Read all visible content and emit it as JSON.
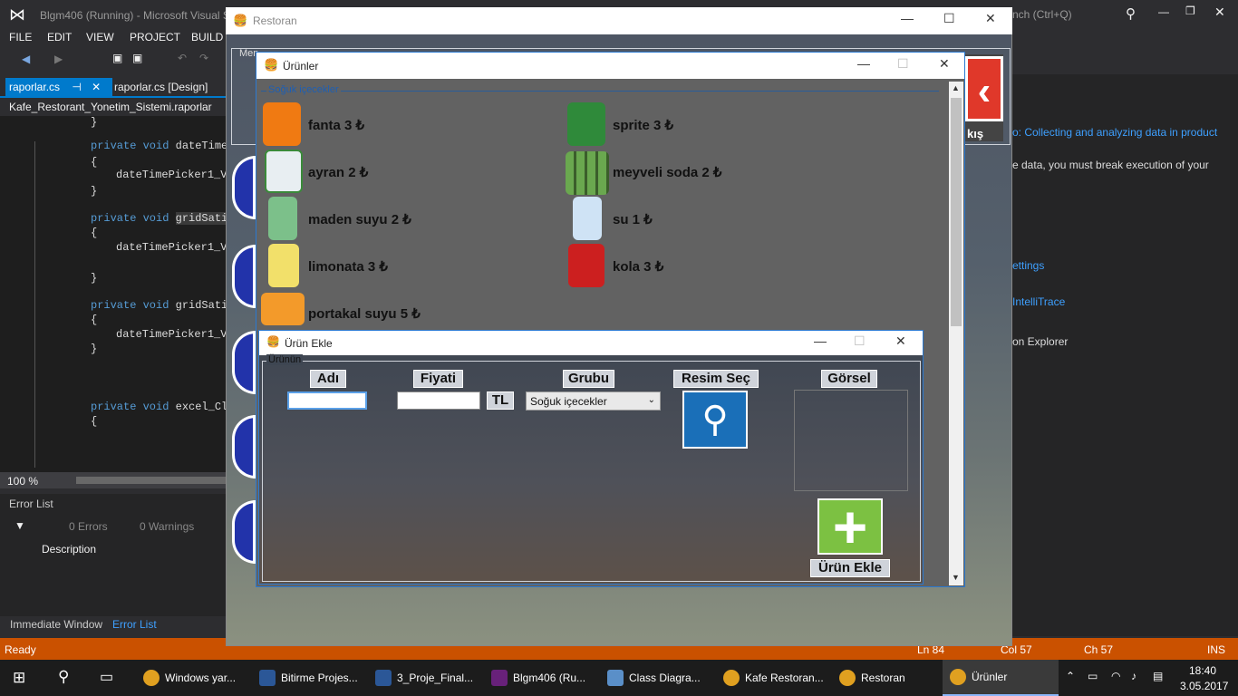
{
  "vs": {
    "title": "Blgm406 (Running) - Microsoft Visual S",
    "menu": [
      "FILE",
      "EDIT",
      "VIEW",
      "PROJECT",
      "BUILD"
    ],
    "search_fragment": "nch (Ctrl+Q)",
    "tabs": [
      "raporlar.cs",
      "raporlar.cs [Design]"
    ],
    "breadcrumb": "Kafe_Restorant_Yonetim_Sistemi.raporlar",
    "code": [
      {
        "text": "}"
      },
      {
        "kw": "private void ",
        "text": "dateTime"
      },
      {
        "text": "{"
      },
      {
        "text": "dateTimePicker1_Va"
      },
      {
        "text": "}"
      },
      {
        "kw": "private void ",
        "text": "gridSati"
      },
      {
        "text": "{"
      },
      {
        "text": "dateTimePicker1_Va"
      },
      {
        "text": "}"
      },
      {
        "kw": "private void ",
        "text": "gridSati"
      },
      {
        "text": "{"
      },
      {
        "text": "dateTimePicker1_Va"
      },
      {
        "text": "}"
      },
      {
        "kw": "private void ",
        "text": "excel_Cl"
      },
      {
        "text": "{"
      }
    ],
    "zoom": "100 %",
    "error_list": {
      "title": "Error List",
      "errors": "0 Errors",
      "warnings": "0 Warnings",
      "column": "Description"
    },
    "bottom_tabs": [
      "Immediate Window",
      "Error List"
    ],
    "right_panel": {
      "link": "o: Collecting and analyzing data in product",
      "text": "e data, you must break execution of your",
      "settings": "ettings",
      "intellitrace": "IntelliTrace",
      "explorer": "on Explorer"
    },
    "status": {
      "ready": "Ready",
      "ln": "Ln 84",
      "col": "Col 57",
      "ch": "Ch 57",
      "ins": "INS"
    }
  },
  "restoran": {
    "title": "Restoran",
    "group_fragment": "Men",
    "exit_fragment": "kış"
  },
  "urunler": {
    "title": "Ürünler",
    "group": "Soğuk içecekler",
    "products": [
      {
        "name": "fanta 3 ₺",
        "color": "#f07a12"
      },
      {
        "name": "sprite 3 ₺",
        "color": "#2f8a3a"
      },
      {
        "name": "ayran 2 ₺",
        "color": "#e8eef2"
      },
      {
        "name": "meyveli soda 2 ₺",
        "color": "#6aa84f"
      },
      {
        "name": "maden suyu 2 ₺",
        "color": "#7cc08a"
      },
      {
        "name": "su 1 ₺",
        "color": "#cfe3f5"
      },
      {
        "name": "limonata 3 ₺",
        "color": "#f2e06a"
      },
      {
        "name": "kola 3 ₺",
        "color": "#cc1f1f"
      },
      {
        "name": "portakal suyu 5 ₺",
        "color": "#f39a2a"
      }
    ]
  },
  "ekle": {
    "title": "Ürün Ekle",
    "group": "Ürünün",
    "labels": {
      "adi": "Adı",
      "fiyati": "Fiyati",
      "tl": "TL",
      "grubu": "Grubu",
      "resim": "Resim Seç",
      "gorsel": "Görsel",
      "ekle": "Ürün Ekle"
    },
    "adi_value": "",
    "fiyati_value": "",
    "grubu_selected": "Soğuk içecekler"
  },
  "taskbar": {
    "items": [
      {
        "label": "Windows yar...",
        "color": "#e0a020"
      },
      {
        "label": "Bitirme Projes...",
        "color": "#2b5797"
      },
      {
        "label": "3_Proje_Final...",
        "color": "#2b5797"
      },
      {
        "label": "Blgm406 (Ru...",
        "color": "#68217a"
      },
      {
        "label": "Class Diagra...",
        "color": "#5a8fc8"
      },
      {
        "label": "Kafe Restoran...",
        "color": "#e0a020"
      },
      {
        "label": "Restoran",
        "color": "#e0a020"
      },
      {
        "label": "Ürünler",
        "color": "#e0a020"
      }
    ],
    "time": "18:40",
    "date": "3.05.2017"
  }
}
